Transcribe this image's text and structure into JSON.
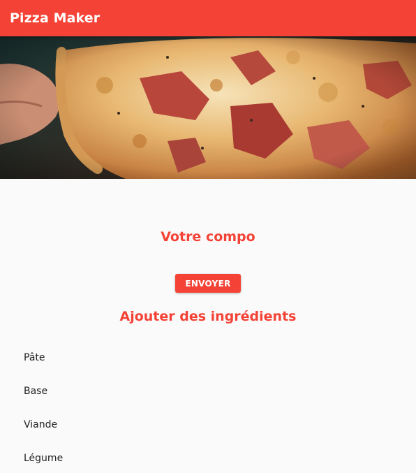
{
  "appbar": {
    "title": "Pizza Maker",
    "color": "#f44336"
  },
  "hero": {
    "image": "pizza-photo"
  },
  "composition": {
    "title": "Votre compo",
    "send_label": "ENVOYER"
  },
  "ingredients": {
    "title": "Ajouter des ingrédients",
    "items": [
      {
        "label": "Pâte"
      },
      {
        "label": "Base"
      },
      {
        "label": "Viande"
      },
      {
        "label": "Légume"
      }
    ]
  }
}
